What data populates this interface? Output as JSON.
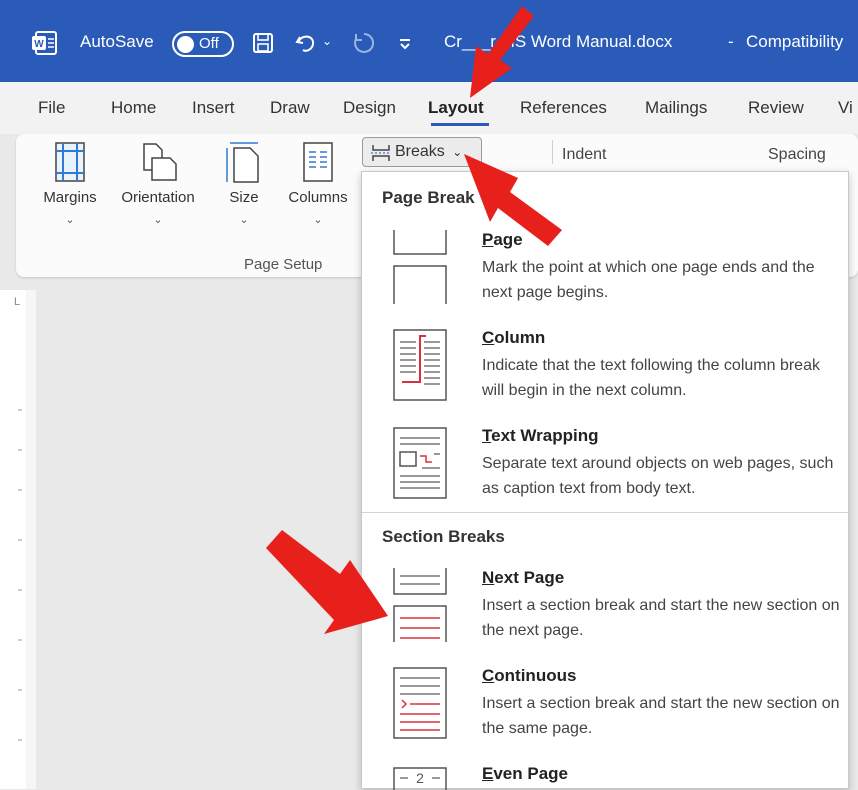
{
  "titlebar": {
    "autosave_label": "AutoSave",
    "autosave_state": "Off",
    "filename": "Cr___r MS Word Manual.docx",
    "separator": "-",
    "mode": "Compatibility"
  },
  "tabs": [
    {
      "label": "File"
    },
    {
      "label": "Home"
    },
    {
      "label": "Insert"
    },
    {
      "label": "Draw"
    },
    {
      "label": "Design"
    },
    {
      "label": "Layout"
    },
    {
      "label": "References"
    },
    {
      "label": "Mailings"
    },
    {
      "label": "Review"
    },
    {
      "label": "Vi"
    }
  ],
  "ribbon": {
    "buttons": [
      {
        "label": "Margins"
      },
      {
        "label": "Orientation"
      },
      {
        "label": "Size"
      },
      {
        "label": "Columns"
      }
    ],
    "breaks_label": "Breaks",
    "indent_label": "Indent",
    "spacing_label": "Spacing",
    "group_label": "Page Setup",
    "chevron": "⌄"
  },
  "breaks_menu": {
    "page_breaks_header": "Page Break",
    "section_breaks_header": "Section Breaks",
    "items": [
      {
        "mnemonic": "P",
        "rest": "age",
        "desc": "Mark the point at which one page ends and the next page begins."
      },
      {
        "mnemonic": "C",
        "rest": "olumn",
        "desc": "Indicate that the text following the column break will begin in the next column."
      },
      {
        "mnemonic": "T",
        "rest": "ext Wrapping",
        "desc": "Separate text around objects on web pages, such as caption text from body text."
      },
      {
        "mnemonic": "N",
        "rest": "ext Page",
        "desc": "Insert a section break and start the new section on the next page."
      },
      {
        "mnemonic": "C",
        "rest": "ontinuous",
        "desc": "Insert a section break and start the new section on the same page."
      },
      {
        "mnemonic": "E",
        "rest": "ven Page",
        "desc": ""
      }
    ]
  },
  "colors": {
    "titlebar_bg": "#2b5bb8",
    "annotation_arrow": "#e8201b",
    "icon_accent": "#d8323c"
  }
}
